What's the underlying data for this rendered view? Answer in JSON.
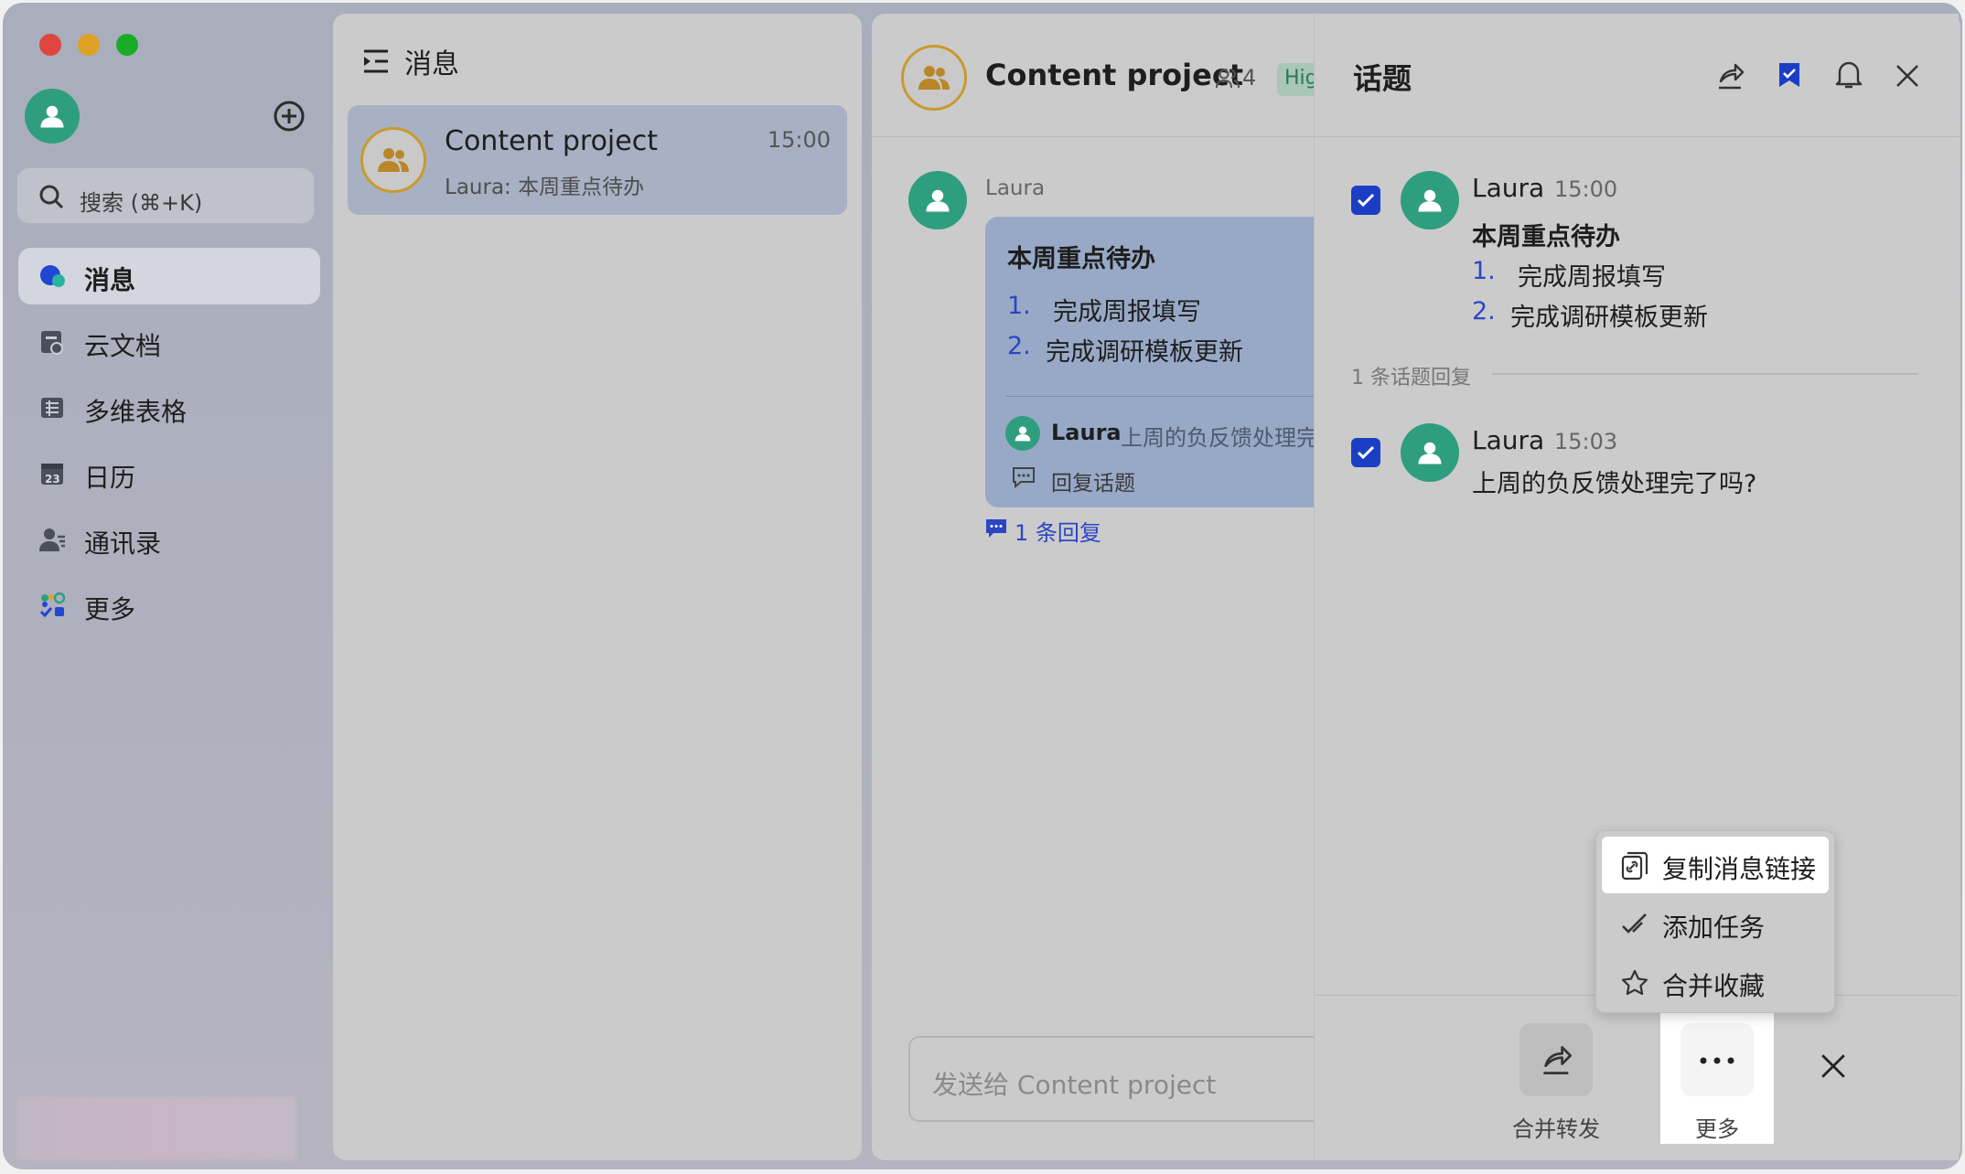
{
  "colors": {
    "accent_blue": "#2c46c4",
    "checkbox_blue": "#1b3fc4",
    "avatar_green": "#2f9e7f",
    "group_ring": "#c99a2e",
    "tag_green": "#3b8f6a"
  },
  "sidebar": {
    "search_placeholder": "搜索 (⌘+K)",
    "items": [
      {
        "label": "消息",
        "icon": "message-bubble-icon",
        "active": true
      },
      {
        "label": "云文档",
        "icon": "cloud-doc-icon"
      },
      {
        "label": "多维表格",
        "icon": "base-table-icon"
      },
      {
        "label": "日历",
        "icon": "calendar-icon"
      },
      {
        "label": "通讯录",
        "icon": "contacts-icon"
      },
      {
        "label": "更多",
        "icon": "apps-grid-icon"
      }
    ],
    "calendar_day": "23"
  },
  "list": {
    "title": "消息",
    "conversation": {
      "name": "Content project",
      "time": "15:00",
      "preview": "Laura: 本周重点待办"
    }
  },
  "chat": {
    "title": "Content project",
    "member_count": "4",
    "tag": "Hig",
    "message": {
      "sender": "Laura",
      "heading": "本周重点待办",
      "items": [
        {
          "num": "1.",
          "text": "完成周报填写"
        },
        {
          "num": "2.",
          "text": "完成调研模板更新"
        }
      ],
      "reply_sender": "Laura",
      "reply_preview": "上周的负反馈处理完",
      "reply_topic": "回复话题",
      "reply_count": "1 条回复"
    },
    "composer_placeholder": "发送给 Content project"
  },
  "thread": {
    "title": "话题",
    "root": {
      "sender": "Laura",
      "time": "15:00",
      "heading": "本周重点待办",
      "items": [
        {
          "num": "1.",
          "text": "完成周报填写"
        },
        {
          "num": "2.",
          "text": "完成调研模板更新"
        }
      ]
    },
    "divider": "1 条话题回复",
    "reply": {
      "sender": "Laura",
      "time": "15:03",
      "text": "上周的负反馈处理完了吗?"
    }
  },
  "menu": {
    "items": [
      {
        "label": "复制消息链接",
        "icon": "link-copy-icon"
      },
      {
        "label": "添加任务",
        "icon": "task-check-icon"
      },
      {
        "label": "合并收藏",
        "icon": "star-icon"
      }
    ]
  },
  "bottom_bar": {
    "forward_label": "合并转发",
    "more_label": "更多"
  }
}
